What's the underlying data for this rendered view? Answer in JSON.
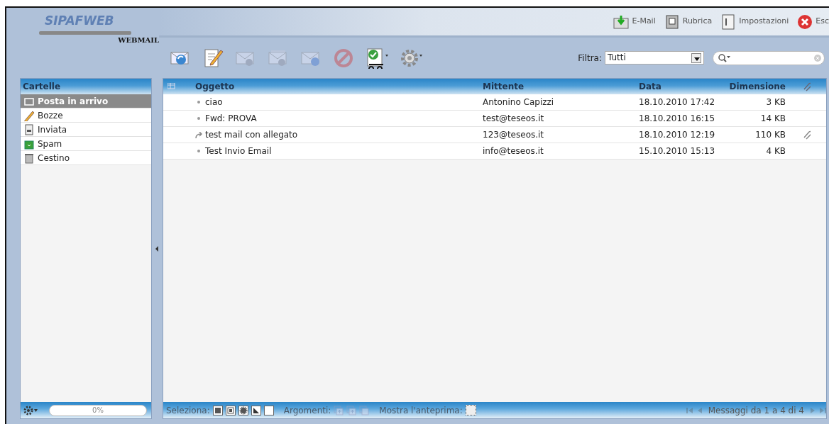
{
  "logo": {
    "title": "SIPAFWEB",
    "subtitle": "WEBMAIL"
  },
  "top_links": [
    {
      "kind": "email",
      "label": "E-Mail"
    },
    {
      "kind": "addressbook",
      "label": "Rubrica"
    },
    {
      "kind": "settings",
      "label": "Impostazioni"
    },
    {
      "kind": "exit",
      "label": "Esc"
    }
  ],
  "toolbar": [
    {
      "kind": "receive",
      "disabled": false,
      "menu": false
    },
    {
      "kind": "compose",
      "disabled": false,
      "menu": false
    },
    {
      "kind": "reply",
      "disabled": true,
      "menu": false
    },
    {
      "kind": "reply-all",
      "disabled": true,
      "menu": false
    },
    {
      "kind": "forward",
      "disabled": true,
      "menu": false
    },
    {
      "kind": "delete",
      "disabled": true,
      "menu": false
    },
    {
      "kind": "mark",
      "disabled": false,
      "menu": true
    },
    {
      "kind": "gear",
      "disabled": false,
      "menu": true
    }
  ],
  "filter": {
    "label": "Filtra:",
    "value": "Tutti"
  },
  "folders": {
    "title": "Cartelle",
    "items": [
      {
        "kind": "inbox",
        "label": "Posta in arrivo",
        "selected": true
      },
      {
        "kind": "drafts",
        "label": "Bozze",
        "selected": false
      },
      {
        "kind": "sent",
        "label": "Inviata",
        "selected": false
      },
      {
        "kind": "spam",
        "label": "Spam",
        "selected": false
      },
      {
        "kind": "trash",
        "label": "Cestino",
        "selected": false
      }
    ]
  },
  "table": {
    "columns": [
      "Oggetto",
      "Mittente",
      "Data",
      "Dimensione"
    ],
    "rows": [
      {
        "kind": "read",
        "subject": "ciao",
        "sender": "Antonino Capizzi",
        "date": "18.10.2010 17:42",
        "size": "3 KB",
        "attachment": false
      },
      {
        "kind": "read",
        "subject": "Fwd: PROVA",
        "sender": "test@teseos.it",
        "date": "18.10.2010 16:15",
        "size": "14 KB",
        "attachment": false
      },
      {
        "kind": "replied",
        "subject": "test mail con allegato",
        "sender": "123@teseos.it",
        "date": "18.10.2010 12:19",
        "size": "110 KB",
        "attachment": true
      },
      {
        "kind": "read",
        "subject": "Test Invio Email",
        "sender": "info@teseos.it",
        "date": "15.10.2010 15:13",
        "size": "4 KB",
        "attachment": false
      }
    ]
  },
  "quota": {
    "text": "0%",
    "level": 0
  },
  "footer": {
    "select_label": "Seleziona:",
    "select_buttons": [
      {
        "kind": "all"
      },
      {
        "kind": "unread"
      },
      {
        "kind": "flagged"
      },
      {
        "kind": "invert"
      },
      {
        "kind": "none"
      }
    ],
    "threads_label": "Argomenti:",
    "thread_buttons": [
      {
        "kind": "expand",
        "disabled": true
      },
      {
        "kind": "expand-all",
        "disabled": true
      },
      {
        "kind": "collapse-all",
        "disabled": true
      }
    ],
    "preview_label": "Mostra l'anteprima:",
    "preview_checked": false,
    "pager_text": "Messaggi da 1 a 4 di 4",
    "pager_disabled": true
  }
}
